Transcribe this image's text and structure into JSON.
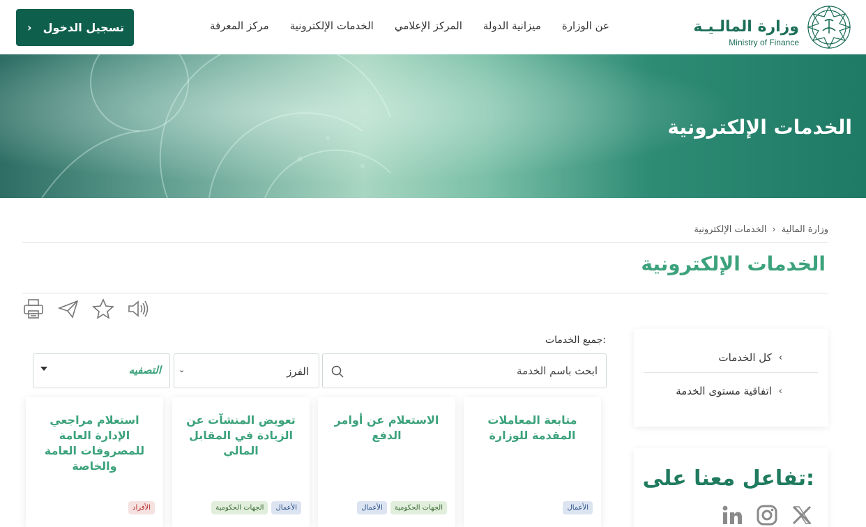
{
  "header": {
    "logo_ar": "وزارة المالـيـة",
    "logo_en": "Ministry of Finance",
    "nav": [
      "عن الوزارة",
      "ميزانية الدولة",
      "المركز الإعلامي",
      "الخدمات الإلكترونية",
      "مركز المعرفة"
    ],
    "login_label": "تسجيل الدخول"
  },
  "hero": {
    "title": "الخدمات الإلكترونية"
  },
  "breadcrumb": {
    "home": "وزارة المالية",
    "current": "الخدمات الإلكترونية"
  },
  "page_title": "الخدمات الإلكترونية",
  "tools": [
    "speaker-icon",
    "star-icon",
    "send-icon",
    "print-icon"
  ],
  "sidebar": {
    "items": [
      {
        "label": "كل الخدمات"
      },
      {
        "label": "اتفاقية مستوى الخدمة"
      }
    ]
  },
  "engage": {
    "title": "تفاعل معنا على:",
    "social": [
      "x-icon",
      "instagram-icon",
      "linkedin-icon"
    ]
  },
  "search": {
    "section_label": "جميع الخدمات:",
    "placeholder": "ابحث باسم الخدمة",
    "sort_value": "الفرز",
    "filter_value": "التصفيه"
  },
  "cards": [
    {
      "title": "متابعة المعاملات المقدمة للوزارة",
      "tags": [
        {
          "label": "الأعمال",
          "kind": "business"
        }
      ]
    },
    {
      "title": "الاستعلام عن أوامر الدفع",
      "tags": [
        {
          "label": "الجهات الحكومية",
          "kind": "gov"
        },
        {
          "label": "الأعمال",
          "kind": "business"
        }
      ]
    },
    {
      "title": "تعويض المنشآت عن الزيادة في المقابل المالي",
      "tags": [
        {
          "label": "الأعمال",
          "kind": "business"
        },
        {
          "label": "الجهات الحكومية",
          "kind": "gov"
        }
      ]
    },
    {
      "title": "استعلام مراجعي الإدارة العامة للمصروفات العامة والخاصة",
      "tags": [
        {
          "label": "الأفراد",
          "kind": "ind"
        }
      ]
    }
  ],
  "colors": {
    "brand_dark": "#0f5f4d",
    "brand_green": "#3ca27c",
    "logo_green": "#1c6e58"
  }
}
